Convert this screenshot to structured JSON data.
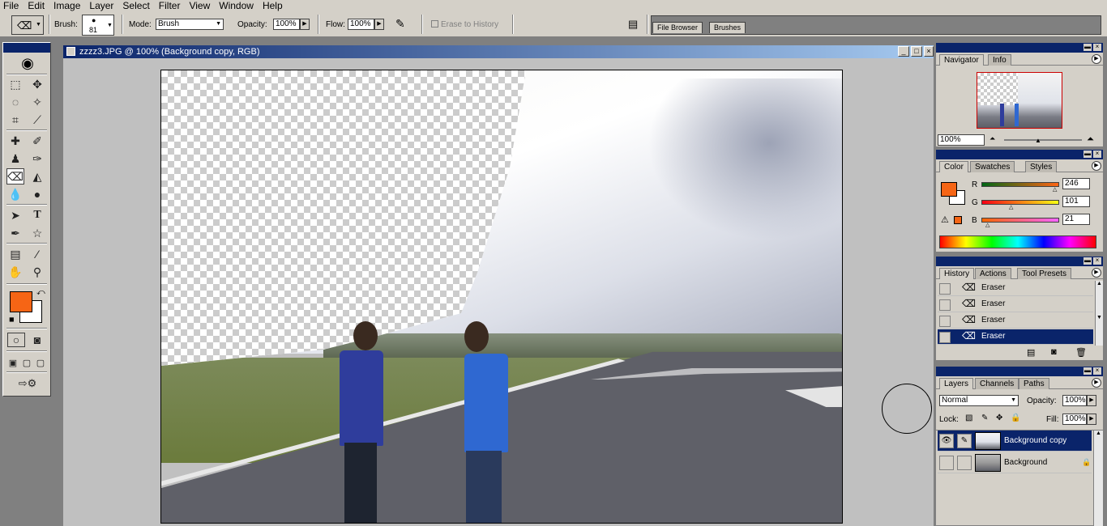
{
  "menu": [
    "File",
    "Edit",
    "Image",
    "Layer",
    "Select",
    "Filter",
    "View",
    "Window",
    "Help"
  ],
  "options": {
    "brush_label": "Brush:",
    "brush_size": "81",
    "mode_label": "Mode:",
    "mode_value": "Brush",
    "opacity_label": "Opacity:",
    "opacity_value": "100%",
    "flow_label": "Flow:",
    "flow_value": "100%",
    "erase_history_label": "Erase to History"
  },
  "palette_well": {
    "tabs": [
      "File Browser",
      "Brushes"
    ]
  },
  "document": {
    "title": "zzzz3.JPG @ 100% (Background copy, RGB)"
  },
  "navigator": {
    "tabs": [
      "Navigator",
      "Info"
    ],
    "zoom": "100%"
  },
  "color": {
    "tabs": [
      "Color",
      "Swatches",
      "Styles"
    ],
    "foreground": "#f66515",
    "r_label": "R",
    "r_value": "246",
    "g_label": "G",
    "g_value": "101",
    "b_label": "B",
    "b_value": "21"
  },
  "history": {
    "tabs": [
      "History",
      "Actions",
      "Tool Presets"
    ],
    "items": [
      "Eraser",
      "Eraser",
      "Eraser",
      "Eraser"
    ]
  },
  "layers": {
    "tabs": [
      "Layers",
      "Channels",
      "Paths"
    ],
    "blend_mode": "Normal",
    "opacity_label": "Opacity:",
    "opacity_value": "100%",
    "lock_label": "Lock:",
    "fill_label": "Fill:",
    "fill_value": "100%",
    "items": [
      "Background copy",
      "Background"
    ]
  }
}
